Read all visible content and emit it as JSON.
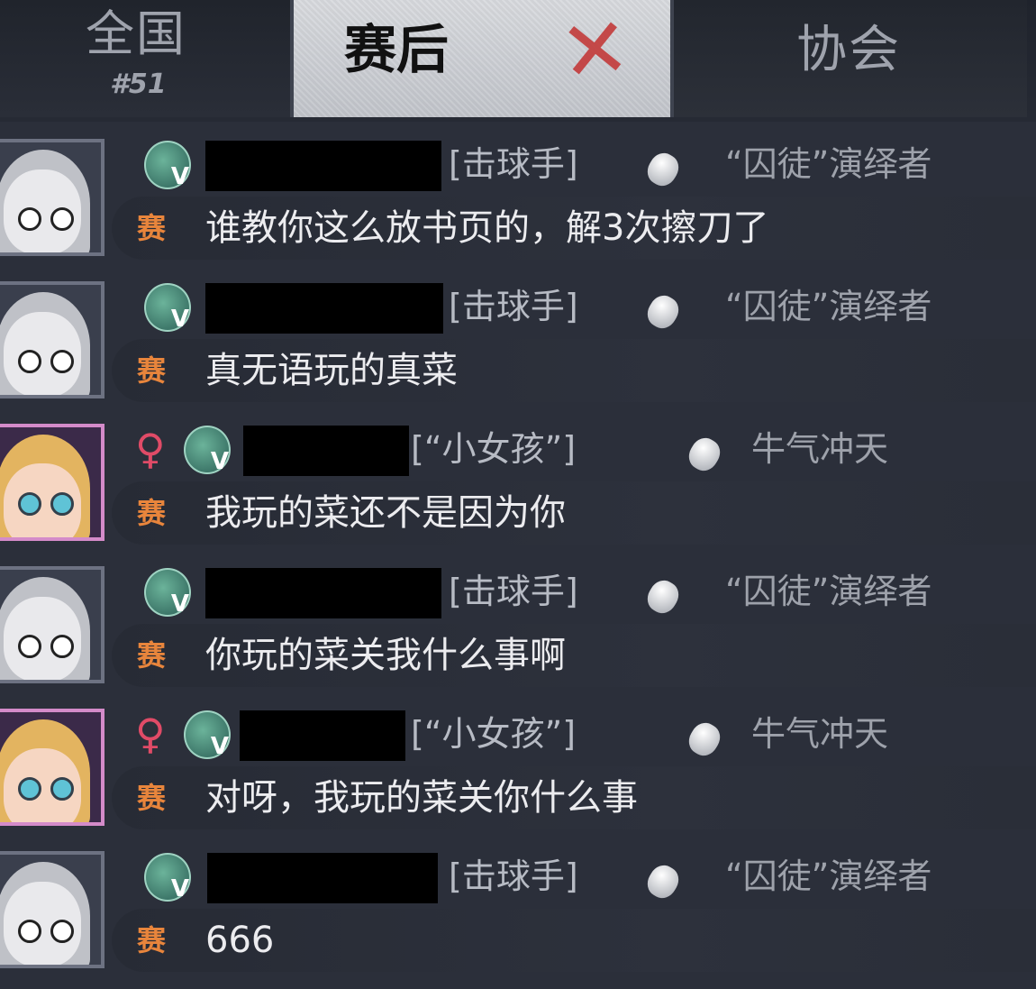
{
  "tabs": {
    "national": {
      "label": "全国",
      "rank": "#51"
    },
    "postgame": {
      "label": "赛后",
      "mark": "✕"
    },
    "association": {
      "label": "协会"
    }
  },
  "messages": [
    {
      "gender": "",
      "role": "[击球手]",
      "title": "“囚徒”演绎者",
      "tag": "赛",
      "text": "谁教你这么放书页的，解3次擦刀了",
      "avatar": "white-hair-girl"
    },
    {
      "gender": "",
      "role": "[击球手]",
      "title": "“囚徒”演绎者",
      "tag": "赛",
      "text": "真无语玩的真菜",
      "avatar": "white-hair-girl"
    },
    {
      "gender": "♀",
      "role": "[“小女孩”]",
      "title": "牛气冲天",
      "tag": "赛",
      "text": "我玩的菜还不是因为你",
      "avatar": "little-girl"
    },
    {
      "gender": "",
      "role": "[击球手]",
      "title": "“囚徒”演绎者",
      "tag": "赛",
      "text": "你玩的菜关我什么事啊",
      "avatar": "white-hair-girl"
    },
    {
      "gender": "♀",
      "role": "[“小女孩”]",
      "title": "牛气冲天",
      "tag": "赛",
      "text": "对呀，我玩的菜关你什么事",
      "avatar": "little-girl"
    },
    {
      "gender": "",
      "role": "[击球手]",
      "title": "“囚徒”演绎者",
      "tag": "赛",
      "text": "666",
      "avatar": "white-hair-girl"
    }
  ],
  "vip_label": "V",
  "colors": {
    "tag": "#e8853c",
    "gender": "#e04b67",
    "active_tab": "#c9cbd0"
  }
}
